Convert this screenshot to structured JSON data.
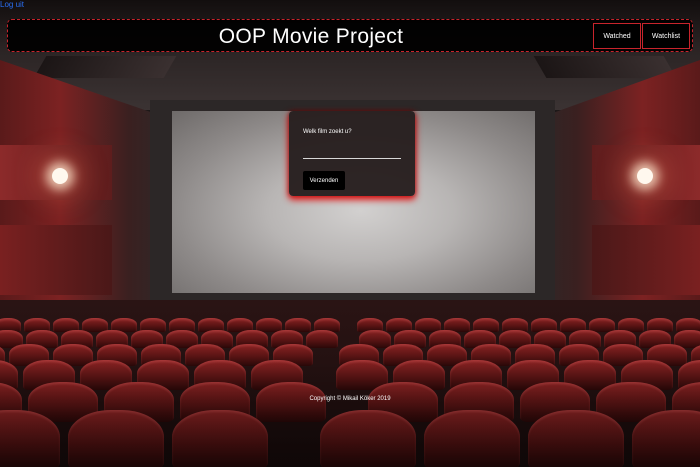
{
  "logout_label": "Log uit",
  "header": {
    "title": "OOP Movie Project",
    "nav": [
      {
        "label": "Watched"
      },
      {
        "label": "Watchlist"
      }
    ]
  },
  "search_card": {
    "label": "Welk film zoekt u?",
    "input_value": "",
    "submit_label": "Verzenden"
  },
  "footer": {
    "text": "Copyright © Mikail Köker 2019"
  },
  "colors": {
    "accent": "#c8242c",
    "link": "#2a6ef2",
    "card_glow": "#e60000"
  }
}
